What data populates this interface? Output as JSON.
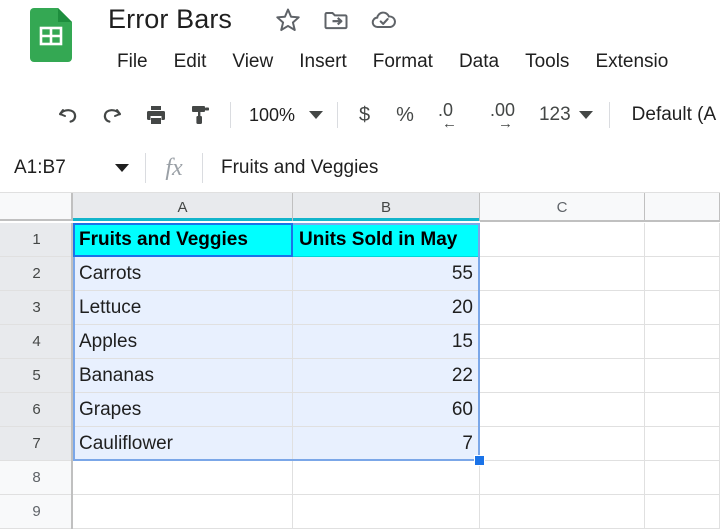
{
  "app": {
    "logo_icon": "google-sheets-logo",
    "doc_title": "Error Bars",
    "title_icons": [
      {
        "name": "star-icon",
        "label": "Star"
      },
      {
        "name": "move-to-folder-icon",
        "label": "Move"
      },
      {
        "name": "cloud-saved-icon",
        "label": "Saved to Drive"
      }
    ]
  },
  "menubar": {
    "items": [
      {
        "label": "File"
      },
      {
        "label": "Edit"
      },
      {
        "label": "View"
      },
      {
        "label": "Insert"
      },
      {
        "label": "Format"
      },
      {
        "label": "Data"
      },
      {
        "label": "Tools"
      },
      {
        "label": "Extensio"
      }
    ]
  },
  "toolbar": {
    "undo_icon": "undo-icon",
    "redo_icon": "redo-icon",
    "print_icon": "print-icon",
    "paint_format_icon": "paint-format-icon",
    "zoom_value": "100%",
    "currency_label": "$",
    "percent_label": "%",
    "decrease_decimal_label": ".0",
    "increase_decimal_label": ".00",
    "number_format_label": "123",
    "font_label": "Default (A"
  },
  "formulabar": {
    "name_box_value": "A1:B7",
    "fx_label": "fx",
    "formula_value": "Fruits and Veggies"
  },
  "grid": {
    "columns": [
      {
        "label": "A",
        "selected": true
      },
      {
        "label": "B",
        "selected": true
      },
      {
        "label": "C",
        "selected": false
      },
      {
        "label": "",
        "selected": false
      }
    ],
    "rows": [
      {
        "label": "1",
        "selected": true
      },
      {
        "label": "2",
        "selected": true
      },
      {
        "label": "3",
        "selected": true
      },
      {
        "label": "4",
        "selected": true
      },
      {
        "label": "5",
        "selected": true
      },
      {
        "label": "6",
        "selected": true
      },
      {
        "label": "7",
        "selected": true
      },
      {
        "label": "8",
        "selected": false
      },
      {
        "label": "9",
        "selected": false
      }
    ],
    "cells": {
      "a1": "Fruits and Veggies",
      "b1": "Units Sold in May",
      "a2": "Carrots",
      "b2": "55",
      "a3": "Lettuce",
      "b3": "20",
      "a4": "Apples",
      "b4": "15",
      "a5": "Bananas",
      "b5": "22",
      "a6": "Grapes",
      "b6": "60",
      "a7": "Cauliflower",
      "b7": "7"
    },
    "selection_range": "A1:B7",
    "active_cell": "A1",
    "header_fill_color": "#00ffff",
    "selection_fill_color": "#e8f0fe",
    "active_border_color": "#1a73e8"
  }
}
